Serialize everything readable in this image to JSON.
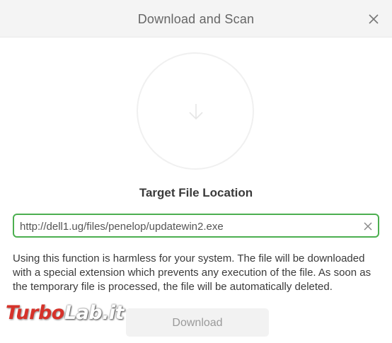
{
  "dialog": {
    "title": "Download and Scan"
  },
  "target": {
    "heading": "Target File Location",
    "url_value": "http://dell1.ug/files/penelop/updatewin2.exe"
  },
  "description": "Using this function is harmless for your system. The file will be downloaded with a special extension which prevents any execution of the file. As soon as the temporary file is processed, the file will be automatically deleted.",
  "actions": {
    "download_label": "Download"
  },
  "watermark": {
    "part1": "Turbo",
    "part2": "Lab.it"
  },
  "colors": {
    "input_border": "#4caf50",
    "watermark_red": "#d6322a"
  }
}
